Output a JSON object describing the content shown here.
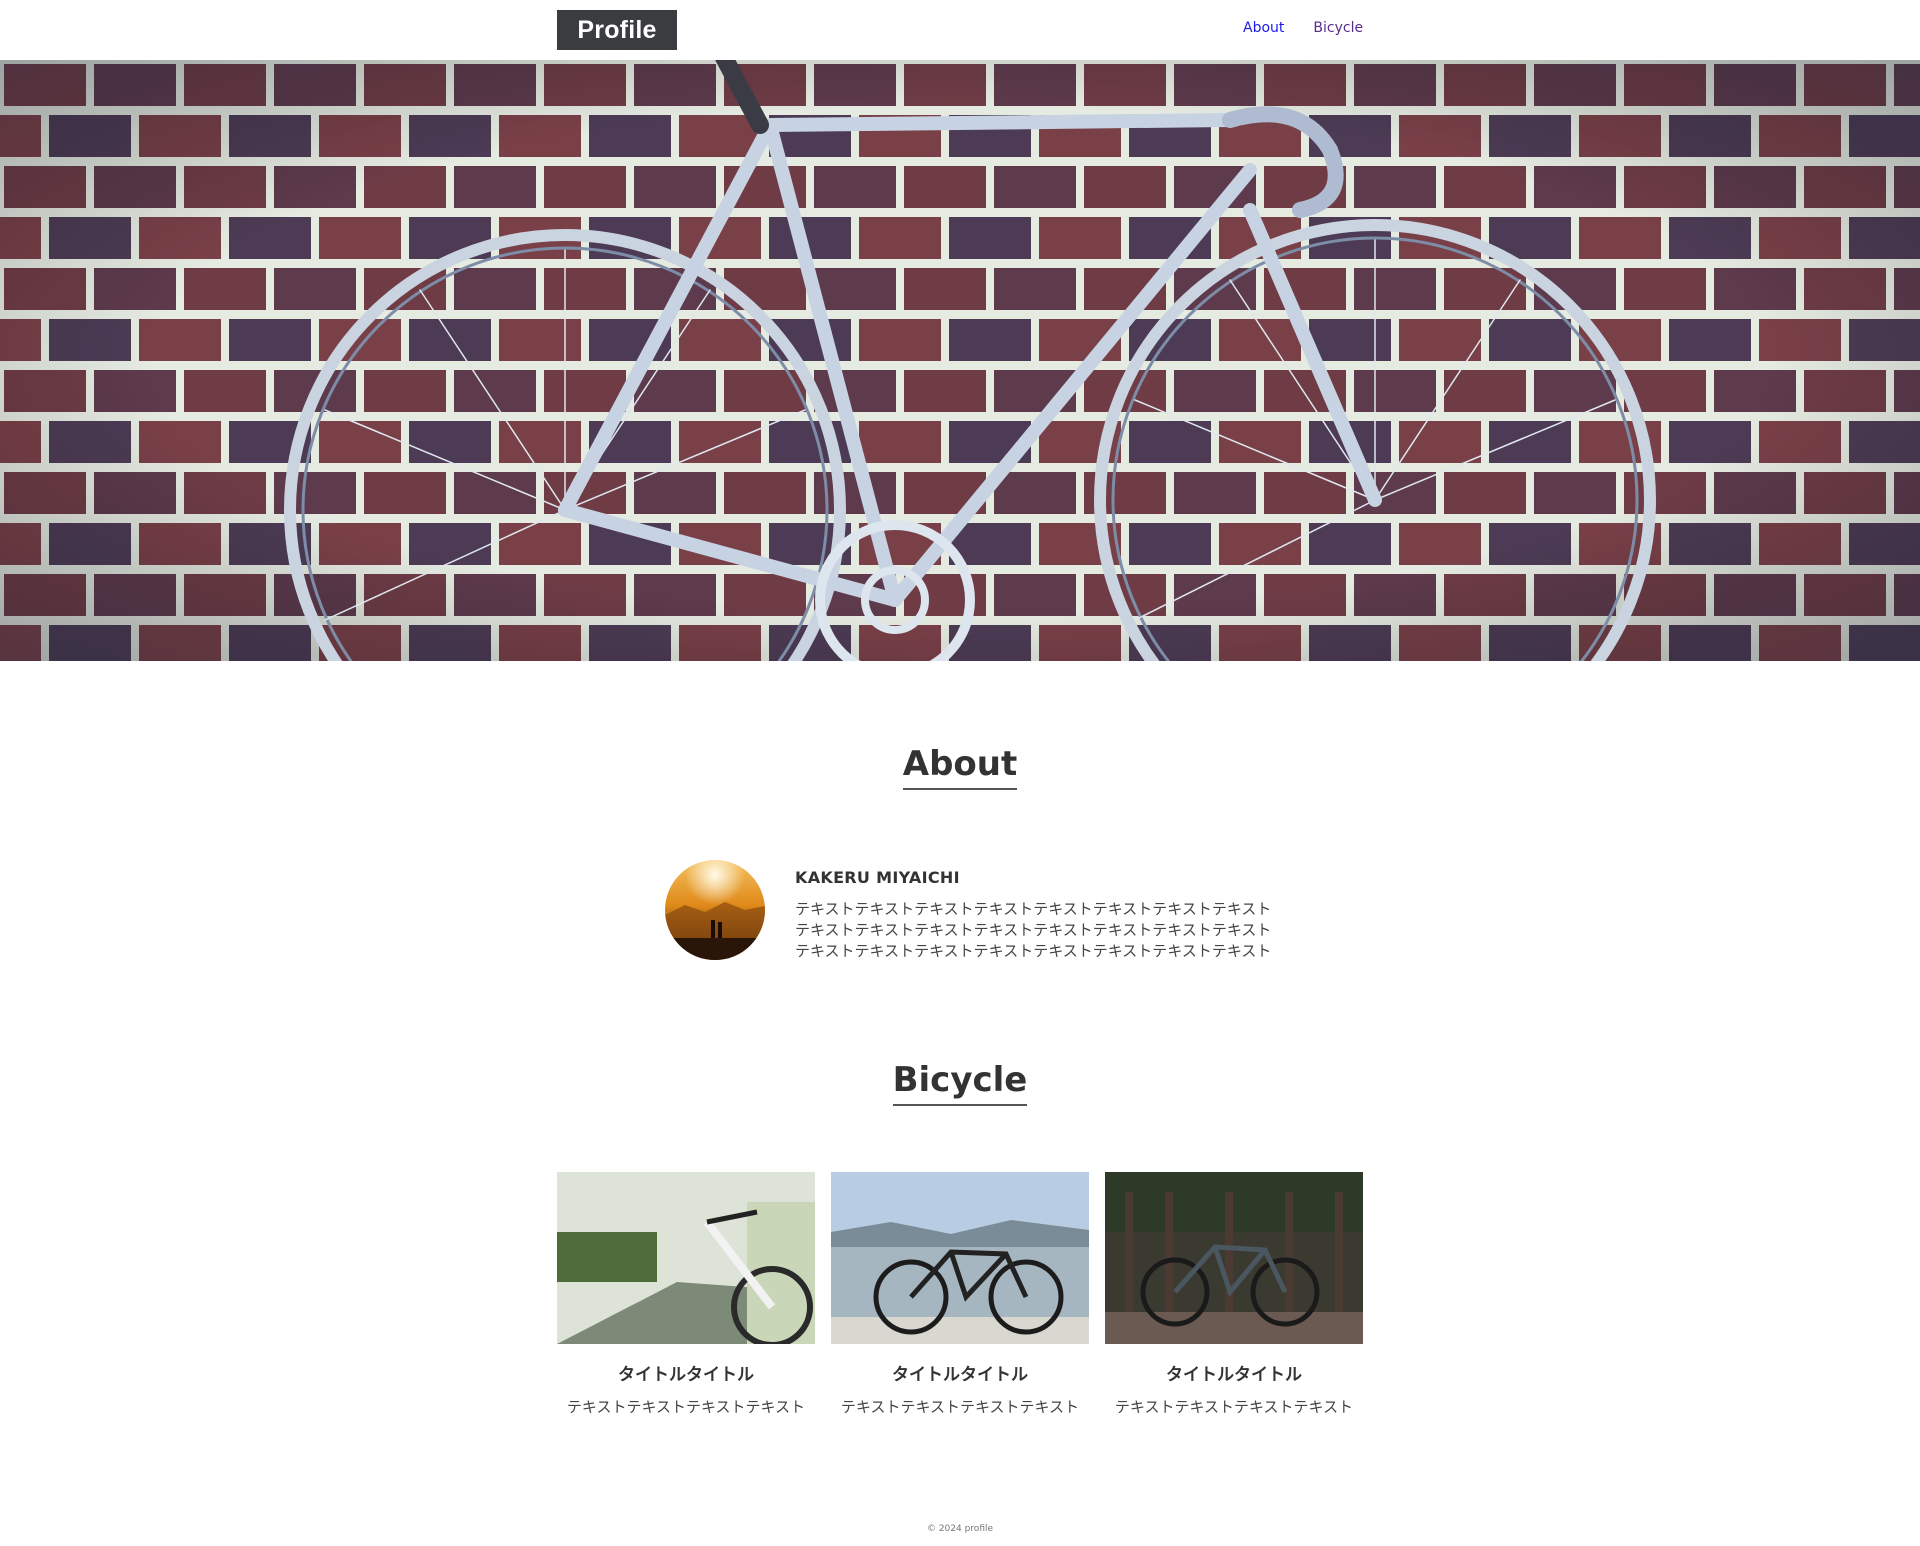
{
  "header": {
    "logo": "Profile",
    "nav": [
      {
        "label": "About"
      },
      {
        "label": "Bicycle"
      }
    ]
  },
  "about": {
    "heading": "About",
    "name": "KAKERU MIYAICHI",
    "text": "テキストテキストテキストテキストテキストテキストテキストテキストテキストテキストテキストテキストテキストテキストテキストテキストテキストテキストテキストテキストテキストテキストテキストテキスト"
  },
  "bicycle": {
    "heading": "Bicycle",
    "cards": [
      {
        "title": "タイトルタイトル",
        "text": "テキストテキストテキストテキスト"
      },
      {
        "title": "タイトルタイトル",
        "text": "テキストテキストテキストテキスト"
      },
      {
        "title": "タイトルタイトル",
        "text": "テキストテキストテキストテキスト"
      }
    ]
  },
  "footer": {
    "copyright": "© 2024 profile"
  },
  "colors": {
    "logo_bg": "#3a3c40",
    "link": "#1a1aee",
    "link_visited": "#5a2b8a",
    "text": "#333333"
  }
}
